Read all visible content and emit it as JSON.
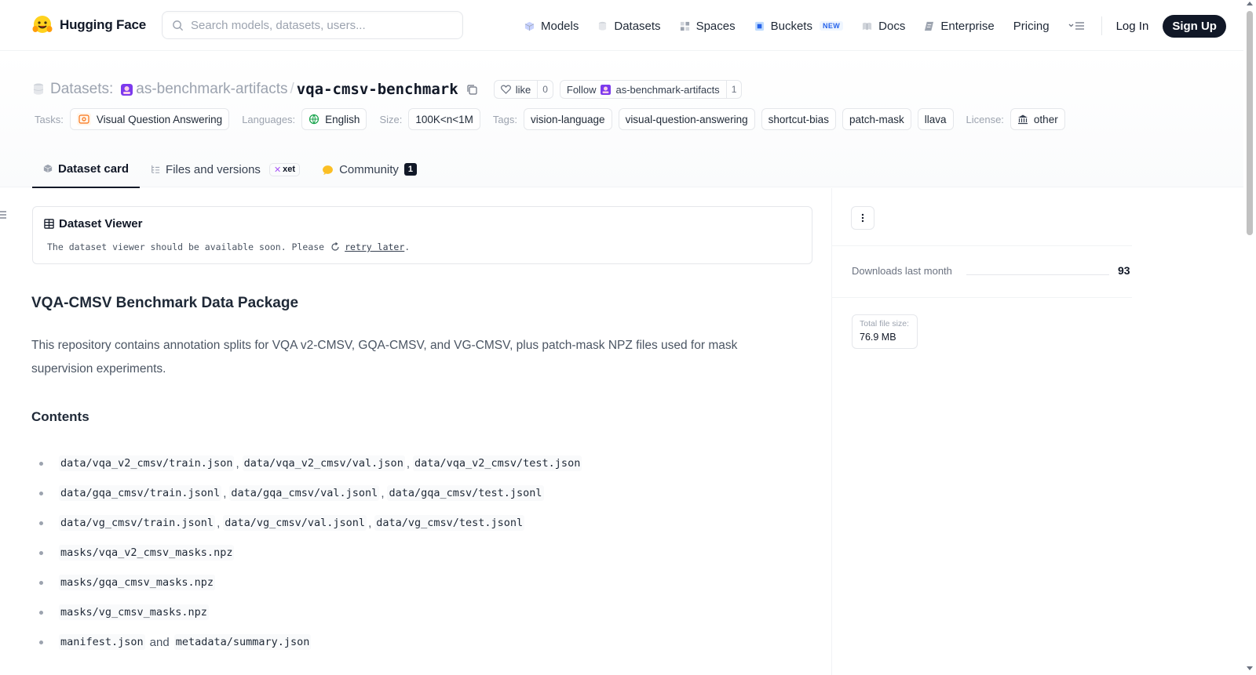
{
  "brand": {
    "name": "Hugging Face",
    "icon": "hugging-face-emoji-icon"
  },
  "search": {
    "placeholder": "Search models, datasets, users...",
    "value": ""
  },
  "nav": {
    "items": [
      {
        "label": "Models",
        "icon": "cube-icon"
      },
      {
        "label": "Datasets",
        "icon": "database-icon"
      },
      {
        "label": "Spaces",
        "icon": "grid-icon"
      },
      {
        "label": "Buckets",
        "icon": "bucket-icon",
        "badge": "NEW"
      },
      {
        "label": "Docs",
        "icon": "book-icon"
      },
      {
        "label": "Enterprise",
        "icon": "enterprise-icon"
      },
      {
        "label": "Pricing"
      }
    ],
    "login": "Log In",
    "signup": "Sign Up"
  },
  "breadcrumb": {
    "section": "Datasets:",
    "org": "as-benchmark-artifacts",
    "separator": "/",
    "repo": "vqa-cmsv-benchmark"
  },
  "like": {
    "label": "like",
    "count": "0"
  },
  "follow": {
    "label": "Follow",
    "org": "as-benchmark-artifacts",
    "count": "1"
  },
  "metadata": {
    "tasks_label": "Tasks:",
    "task": "Visual Question Answering",
    "languages_label": "Languages:",
    "language": "English",
    "size_label": "Size:",
    "size": "100K<n<1M",
    "tags_label": "Tags:",
    "tags": [
      "vision-language",
      "visual-question-answering",
      "shortcut-bias",
      "patch-mask",
      "llava"
    ],
    "license_label": "License:",
    "license": "other"
  },
  "tabs": {
    "card": "Dataset card",
    "files": "Files and versions",
    "xet": "xet",
    "community": "Community",
    "community_count": "1"
  },
  "viewer": {
    "title": "Dataset Viewer",
    "message": "The dataset viewer should be available soon. Please",
    "link": "retry later",
    "suffix": "."
  },
  "content": {
    "heading": "VQA-CMSV Benchmark Data Package",
    "description": "This repository contains annotation splits for VQA v2-CMSV, GQA-CMSV, and VG-CMSV, plus patch-mask NPZ files used for mask supervision experiments.",
    "contents_heading": "Contents",
    "files": [
      {
        "a": "data/vqa_v2_cmsv/train.json",
        "b": "data/vqa_v2_cmsv/val.json",
        "c": "data/vqa_v2_cmsv/test.json"
      },
      {
        "a": "data/gqa_cmsv/train.jsonl",
        "b": "data/gqa_cmsv/val.jsonl",
        "c": "data/gqa_cmsv/test.jsonl"
      },
      {
        "a": "data/vg_cmsv/train.jsonl",
        "b": "data/vg_cmsv/val.jsonl",
        "c": "data/vg_cmsv/test.jsonl"
      }
    ],
    "masks": [
      "masks/vqa_v2_cmsv_masks.npz",
      "masks/gqa_cmsv_masks.npz",
      "masks/vg_cmsv_masks.npz"
    ],
    "last_item": {
      "a": "manifest.json",
      "join": "and",
      "b": "metadata/summary.json"
    },
    "list_separator": ","
  },
  "sidebar": {
    "downloads_label": "Downloads last month",
    "downloads_value": "93",
    "file_size_label": "Total file size:",
    "file_size_value": "76.9 MB"
  },
  "colors": {
    "accent_dark": "#111827",
    "new_badge": "#2563eb",
    "org_avatar": "#7c3aed"
  }
}
